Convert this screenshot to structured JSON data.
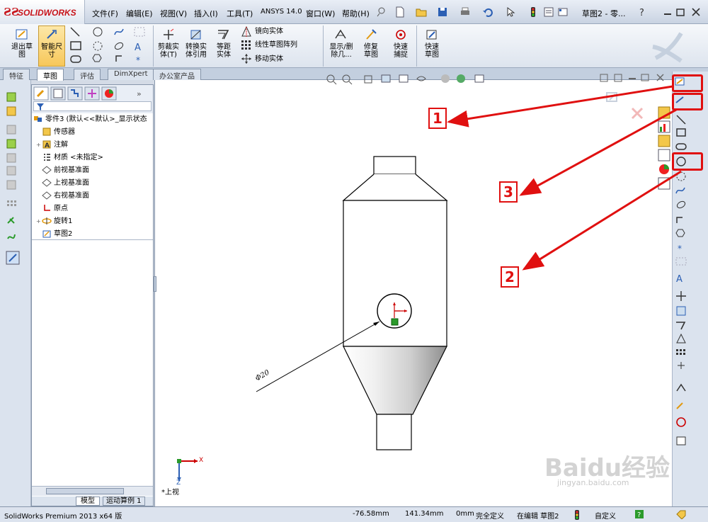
{
  "app": {
    "name": "SOLIDWORKS",
    "window_title": "草图2 - 零..."
  },
  "menu": [
    "文件(F)",
    "编辑(E)",
    "视图(V)",
    "插入(I)",
    "工具(T)",
    "ANSYS 14.0",
    "窗口(W)",
    "帮助(H)"
  ],
  "commands": {
    "exit_sketch": "退出草图",
    "smart_dim": "智能尺寸",
    "trim": "剪裁实体(T)",
    "convert": "转换实体引用",
    "offset": "等距实体",
    "mirror": "镜向实体",
    "linear_array": "线性草图阵列",
    "move": "移动实体",
    "display_delete": "显示/删除几...",
    "repair": "修复草图",
    "quick_snap": "快速捕捉",
    "rapid_sketch": "快速草图"
  },
  "tabs": [
    "特征",
    "草图",
    "评估",
    "DimXpert",
    "办公室产品"
  ],
  "active_tab": "草图",
  "tree": {
    "root": "零件3 (默认<<默认>_显示状态",
    "items": [
      "传感器",
      "注解",
      "材质 <未指定>",
      "前视基准面",
      "上视基准面",
      "右视基准面",
      "原点",
      "旋转1",
      "草图2"
    ],
    "bottom_tabs": [
      "模型",
      "运动算例 1"
    ]
  },
  "drawing": {
    "dimension": "Φ20",
    "view_label": "*上视",
    "axis_x": "X",
    "axis_z": "Z"
  },
  "callouts": [
    "1",
    "2",
    "3"
  ],
  "status": {
    "product": "SolidWorks Premium 2013 x64 版",
    "x": "-76.58mm",
    "y": "141.34mm",
    "z": "0mm",
    "def": "完全定义",
    "editing": "在编辑 草图2",
    "custom": "自定义"
  },
  "watermark": {
    "text": "Baidu经验",
    "sub": "jingyan.baidu.com"
  },
  "colors": {
    "accent_red": "#e01010",
    "active_btn": "#f7c75a"
  }
}
